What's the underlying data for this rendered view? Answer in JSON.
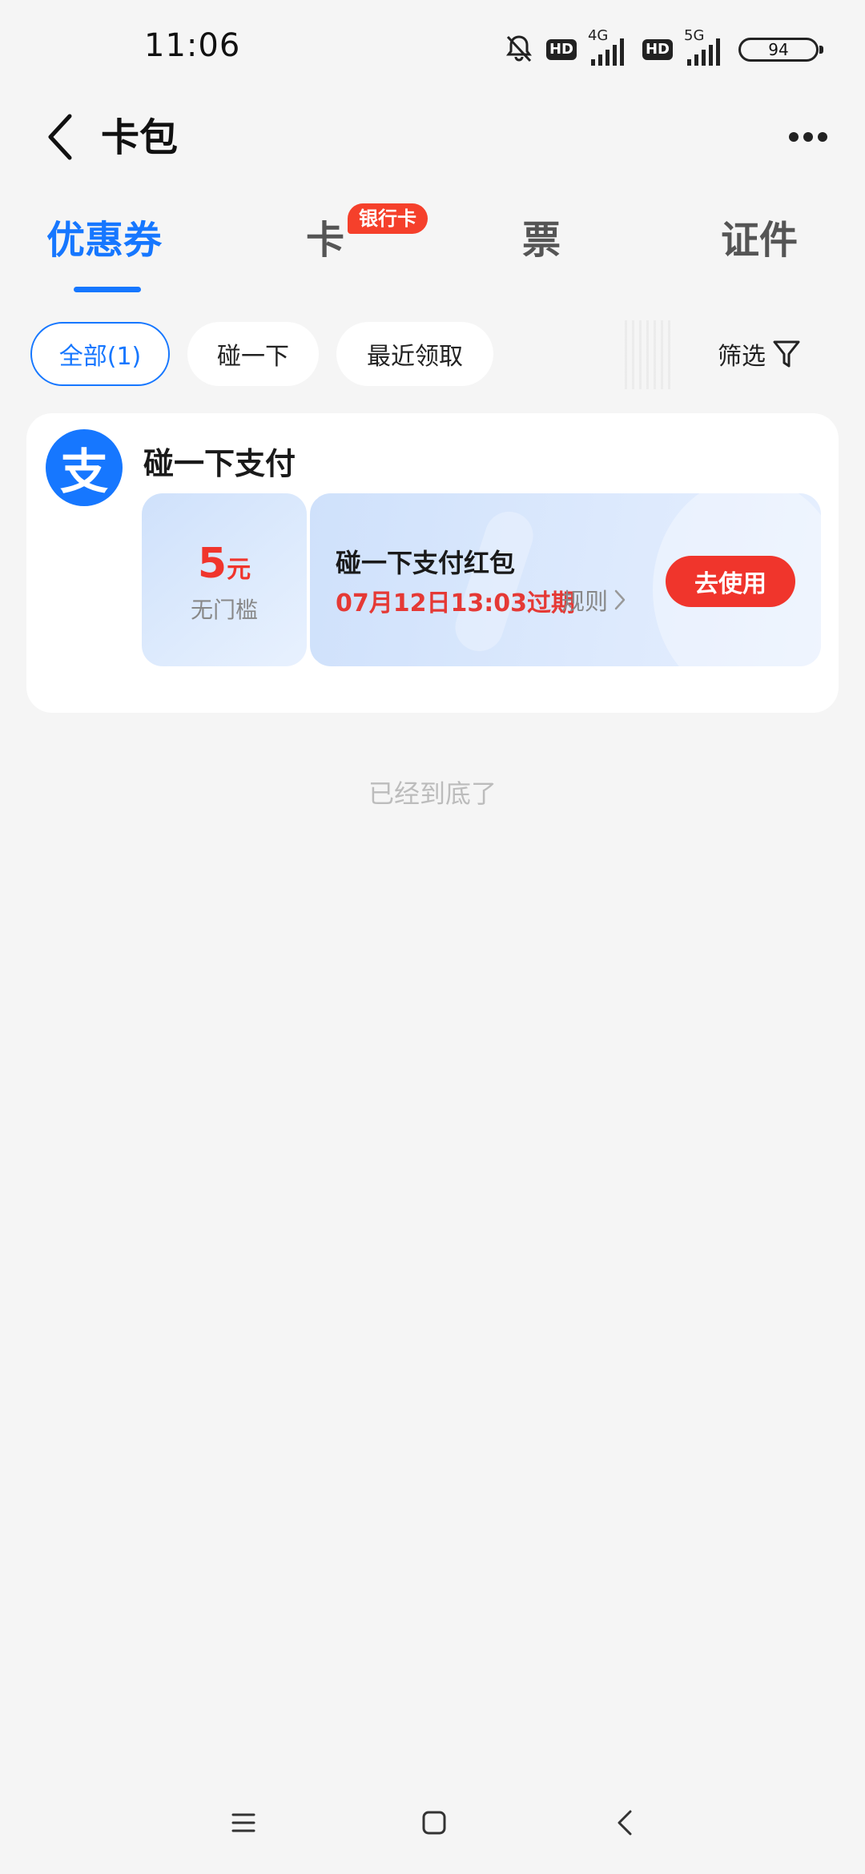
{
  "status_bar": {
    "time": "11:06",
    "hd1": "HD",
    "net1": "4G",
    "hd2": "HD",
    "net2": "5G",
    "battery": "94"
  },
  "header": {
    "title": "卡包",
    "back_icon": "chevron-left-icon",
    "more_icon": "more-horizontal-icon"
  },
  "tabs": [
    {
      "label": "优惠券",
      "active": true
    },
    {
      "label": "卡",
      "badge": "银行卡"
    },
    {
      "label": "票"
    },
    {
      "label": "证件"
    }
  ],
  "filters": {
    "chips": [
      "全部(1)",
      "碰一下",
      "最近领取"
    ],
    "filter_label": "筛选",
    "filter_icon": "funnel-icon"
  },
  "card": {
    "merchant_name": "碰一下支付",
    "merchant_logo": "支",
    "coupon": {
      "amount": "5",
      "unit": "元",
      "threshold": "无门槛",
      "title": "碰一下支付红包",
      "expiry": "07月12日13:03过期",
      "rules": "规则",
      "use_button": "去使用"
    },
    "accent_color": "#f0352c",
    "brand_color": "#1677ff"
  },
  "end_text": "已经到底了",
  "nav_bar": {
    "menu_icon": "menu-icon",
    "home_icon": "square-home-icon",
    "back_icon": "chevron-left-icon"
  }
}
